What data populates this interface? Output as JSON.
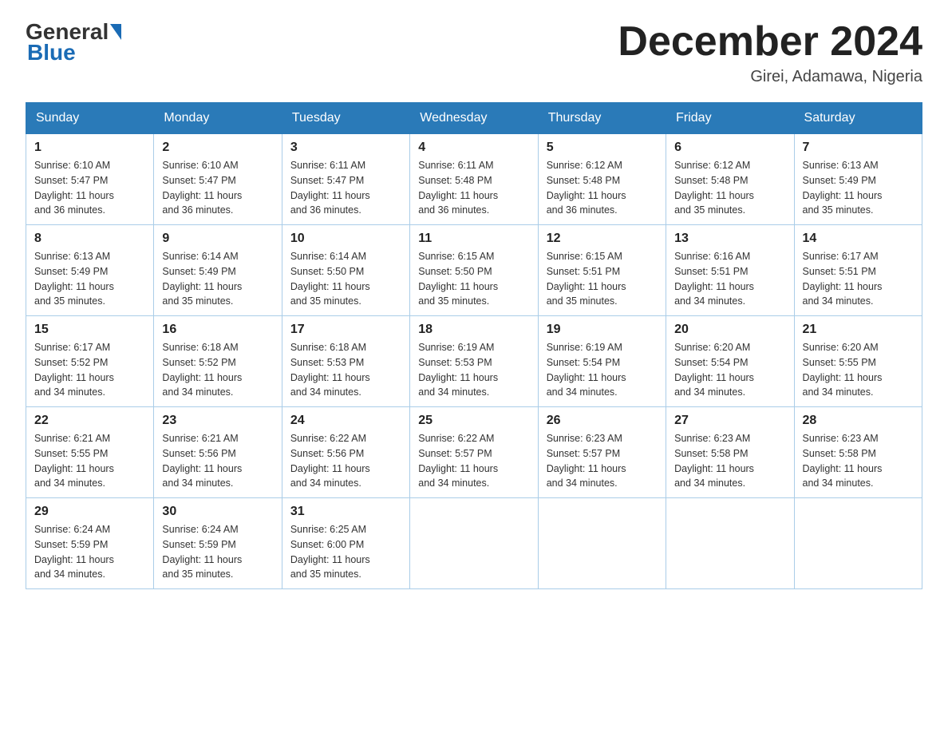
{
  "header": {
    "logo_text_general": "General",
    "logo_text_blue": "Blue",
    "month_title": "December 2024",
    "location": "Girei, Adamawa, Nigeria"
  },
  "days_of_week": [
    "Sunday",
    "Monday",
    "Tuesday",
    "Wednesday",
    "Thursday",
    "Friday",
    "Saturday"
  ],
  "weeks": [
    [
      {
        "day": "1",
        "sunrise": "6:10 AM",
        "sunset": "5:47 PM",
        "daylight": "11 hours and 36 minutes."
      },
      {
        "day": "2",
        "sunrise": "6:10 AM",
        "sunset": "5:47 PM",
        "daylight": "11 hours and 36 minutes."
      },
      {
        "day": "3",
        "sunrise": "6:11 AM",
        "sunset": "5:47 PM",
        "daylight": "11 hours and 36 minutes."
      },
      {
        "day": "4",
        "sunrise": "6:11 AM",
        "sunset": "5:48 PM",
        "daylight": "11 hours and 36 minutes."
      },
      {
        "day": "5",
        "sunrise": "6:12 AM",
        "sunset": "5:48 PM",
        "daylight": "11 hours and 36 minutes."
      },
      {
        "day": "6",
        "sunrise": "6:12 AM",
        "sunset": "5:48 PM",
        "daylight": "11 hours and 35 minutes."
      },
      {
        "day": "7",
        "sunrise": "6:13 AM",
        "sunset": "5:49 PM",
        "daylight": "11 hours and 35 minutes."
      }
    ],
    [
      {
        "day": "8",
        "sunrise": "6:13 AM",
        "sunset": "5:49 PM",
        "daylight": "11 hours and 35 minutes."
      },
      {
        "day": "9",
        "sunrise": "6:14 AM",
        "sunset": "5:49 PM",
        "daylight": "11 hours and 35 minutes."
      },
      {
        "day": "10",
        "sunrise": "6:14 AM",
        "sunset": "5:50 PM",
        "daylight": "11 hours and 35 minutes."
      },
      {
        "day": "11",
        "sunrise": "6:15 AM",
        "sunset": "5:50 PM",
        "daylight": "11 hours and 35 minutes."
      },
      {
        "day": "12",
        "sunrise": "6:15 AM",
        "sunset": "5:51 PM",
        "daylight": "11 hours and 35 minutes."
      },
      {
        "day": "13",
        "sunrise": "6:16 AM",
        "sunset": "5:51 PM",
        "daylight": "11 hours and 34 minutes."
      },
      {
        "day": "14",
        "sunrise": "6:17 AM",
        "sunset": "5:51 PM",
        "daylight": "11 hours and 34 minutes."
      }
    ],
    [
      {
        "day": "15",
        "sunrise": "6:17 AM",
        "sunset": "5:52 PM",
        "daylight": "11 hours and 34 minutes."
      },
      {
        "day": "16",
        "sunrise": "6:18 AM",
        "sunset": "5:52 PM",
        "daylight": "11 hours and 34 minutes."
      },
      {
        "day": "17",
        "sunrise": "6:18 AM",
        "sunset": "5:53 PM",
        "daylight": "11 hours and 34 minutes."
      },
      {
        "day": "18",
        "sunrise": "6:19 AM",
        "sunset": "5:53 PM",
        "daylight": "11 hours and 34 minutes."
      },
      {
        "day": "19",
        "sunrise": "6:19 AM",
        "sunset": "5:54 PM",
        "daylight": "11 hours and 34 minutes."
      },
      {
        "day": "20",
        "sunrise": "6:20 AM",
        "sunset": "5:54 PM",
        "daylight": "11 hours and 34 minutes."
      },
      {
        "day": "21",
        "sunrise": "6:20 AM",
        "sunset": "5:55 PM",
        "daylight": "11 hours and 34 minutes."
      }
    ],
    [
      {
        "day": "22",
        "sunrise": "6:21 AM",
        "sunset": "5:55 PM",
        "daylight": "11 hours and 34 minutes."
      },
      {
        "day": "23",
        "sunrise": "6:21 AM",
        "sunset": "5:56 PM",
        "daylight": "11 hours and 34 minutes."
      },
      {
        "day": "24",
        "sunrise": "6:22 AM",
        "sunset": "5:56 PM",
        "daylight": "11 hours and 34 minutes."
      },
      {
        "day": "25",
        "sunrise": "6:22 AM",
        "sunset": "5:57 PM",
        "daylight": "11 hours and 34 minutes."
      },
      {
        "day": "26",
        "sunrise": "6:23 AM",
        "sunset": "5:57 PM",
        "daylight": "11 hours and 34 minutes."
      },
      {
        "day": "27",
        "sunrise": "6:23 AM",
        "sunset": "5:58 PM",
        "daylight": "11 hours and 34 minutes."
      },
      {
        "day": "28",
        "sunrise": "6:23 AM",
        "sunset": "5:58 PM",
        "daylight": "11 hours and 34 minutes."
      }
    ],
    [
      {
        "day": "29",
        "sunrise": "6:24 AM",
        "sunset": "5:59 PM",
        "daylight": "11 hours and 34 minutes."
      },
      {
        "day": "30",
        "sunrise": "6:24 AM",
        "sunset": "5:59 PM",
        "daylight": "11 hours and 35 minutes."
      },
      {
        "day": "31",
        "sunrise": "6:25 AM",
        "sunset": "6:00 PM",
        "daylight": "11 hours and 35 minutes."
      },
      null,
      null,
      null,
      null
    ]
  ],
  "sunrise_label": "Sunrise:",
  "sunset_label": "Sunset:",
  "daylight_label": "Daylight:"
}
